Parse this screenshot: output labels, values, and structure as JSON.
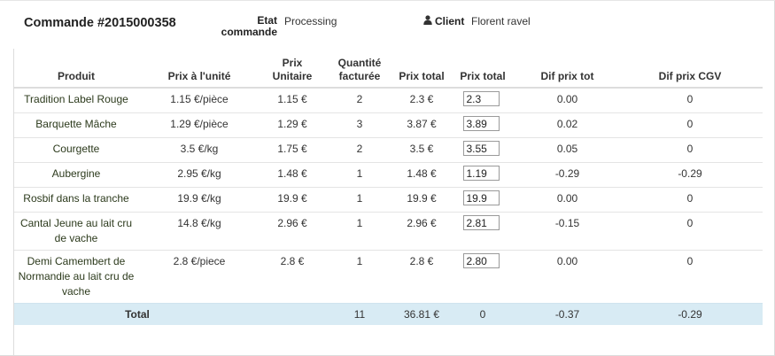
{
  "order": {
    "title": "Commande #2015000358",
    "etat_label_1": "Etat",
    "etat_label_2": "commande",
    "etat_value": "Processing",
    "client_label": "Client",
    "client_value": "Florent ravel"
  },
  "icons": {
    "client": "user-icon"
  },
  "table": {
    "headers": {
      "produit": "Produit",
      "prix_unite": "Prix à l'unité",
      "prix_unitaire_1": "Prix",
      "prix_unitaire_2": "Unitaire",
      "quantite_1": "Quantité",
      "quantite_2": "facturée",
      "prix_total": "Prix total",
      "prix_total_input": "Prix total",
      "dif_prix_tot": "Dif prix tot",
      "dif_prix_cgv": "Dif prix CGV"
    },
    "rows": [
      {
        "produit": "Tradition Label Rouge",
        "prix_unite": "1.15 €/pièce",
        "prix_unitaire": "1.15 €",
        "quantite": "2",
        "prix_total": "2.3 €",
        "input_value": "2.3",
        "dif_tot": "0.00",
        "dif_cgv": "0"
      },
      {
        "produit": "Barquette Mâche",
        "prix_unite": "1.29 €/pièce",
        "prix_unitaire": "1.29 €",
        "quantite": "3",
        "prix_total": "3.87 €",
        "input_value": "3.89",
        "dif_tot": "0.02",
        "dif_cgv": "0"
      },
      {
        "produit": "Courgette",
        "prix_unite": "3.5 €/kg",
        "prix_unitaire": "1.75 €",
        "quantite": "2",
        "prix_total": "3.5 €",
        "input_value": "3.55",
        "dif_tot": "0.05",
        "dif_cgv": "0"
      },
      {
        "produit": "Aubergine",
        "prix_unite": "2.95 €/kg",
        "prix_unitaire": "1.48 €",
        "quantite": "1",
        "prix_total": "1.48 €",
        "input_value": "1.19",
        "dif_tot": "-0.29",
        "dif_cgv": "-0.29"
      },
      {
        "produit": "Rosbif dans la tranche",
        "prix_unite": "19.9 €/kg",
        "prix_unitaire": "19.9 €",
        "quantite": "1",
        "prix_total": "19.9 €",
        "input_value": "19.9",
        "dif_tot": "0.00",
        "dif_cgv": "0"
      },
      {
        "produit": "Cantal Jeune au lait cru de vache",
        "prix_unite": "14.8 €/kg",
        "prix_unitaire": "2.96 €",
        "quantite": "1",
        "prix_total": "2.96 €",
        "input_value": "2.81",
        "dif_tot": "-0.15",
        "dif_cgv": "0"
      },
      {
        "produit": "Demi Camembert de Normandie au lait cru de vache",
        "prix_unite": "2.8 €/piece",
        "prix_unitaire": "2.8 €",
        "quantite": "1",
        "prix_total": "2.8 €",
        "input_value": "2.80",
        "dif_tot": "0.00",
        "dif_cgv": "0"
      }
    ],
    "total": {
      "label": "Total",
      "quantite": "11",
      "prix_total": "36.81 €",
      "prix_total_input": "0",
      "dif_tot": "-0.37",
      "dif_cgv": "-0.29"
    }
  },
  "colors": {
    "total_row_bg": "#d8ebf4",
    "product_text": "#2c3a1c"
  }
}
